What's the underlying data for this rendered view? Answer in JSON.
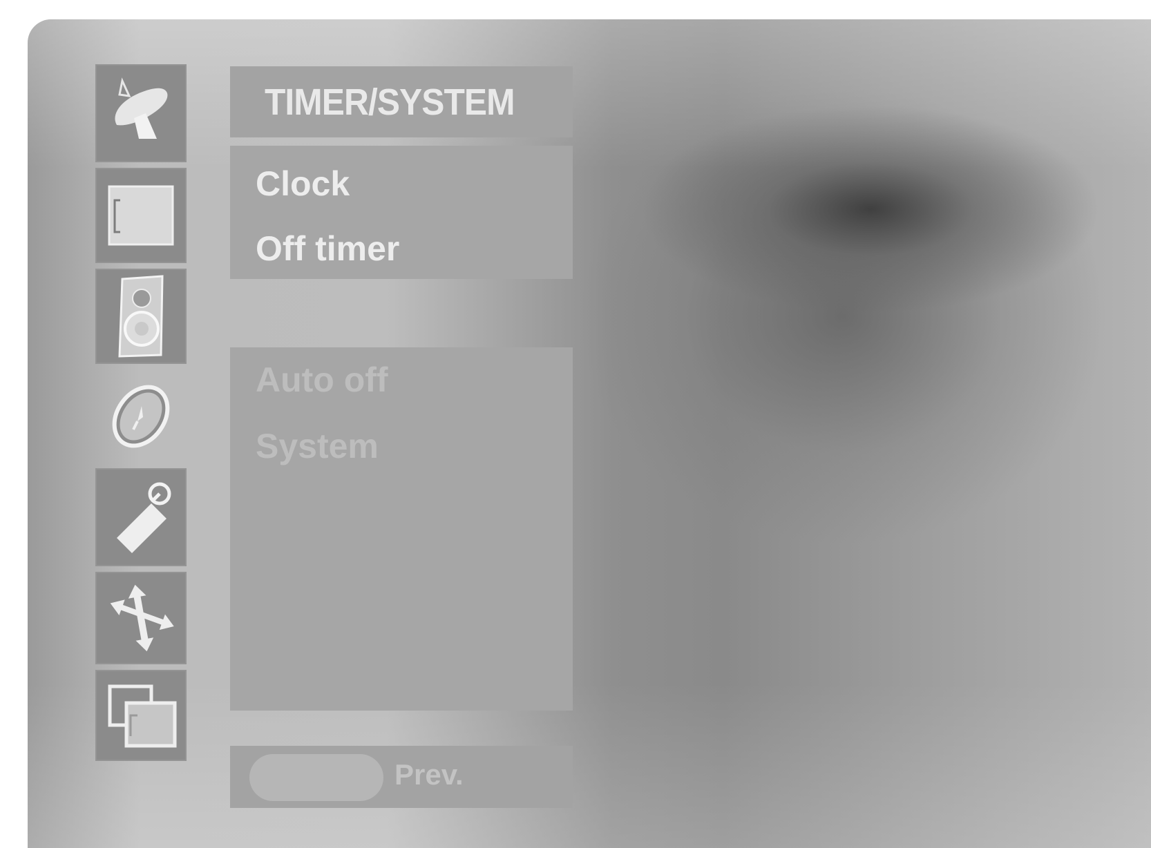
{
  "menu": {
    "title": "TIMER/SYSTEM",
    "groups": [
      {
        "items": [
          {
            "label": "Clock"
          },
          {
            "label": "Off timer"
          }
        ]
      },
      {
        "items": [
          {
            "label": "Auto off"
          },
          {
            "label": "System"
          }
        ]
      }
    ]
  },
  "sidebar": {
    "items": [
      {
        "icon": "satellite-dish-icon",
        "selected": false
      },
      {
        "icon": "screen-icon",
        "selected": false
      },
      {
        "icon": "speaker-icon",
        "selected": false
      },
      {
        "icon": "clock-icon",
        "selected": true
      },
      {
        "icon": "tag-icon",
        "selected": false
      },
      {
        "icon": "move-arrows-icon",
        "selected": false
      },
      {
        "icon": "pip-windows-icon",
        "selected": false
      }
    ]
  },
  "footer": {
    "prev_label": "Prev."
  },
  "colors": {
    "panel": "#a6a6a6",
    "tile": "#8b8b8b",
    "active_text": "#ededed",
    "inactive_text": "#bdbdbd"
  }
}
